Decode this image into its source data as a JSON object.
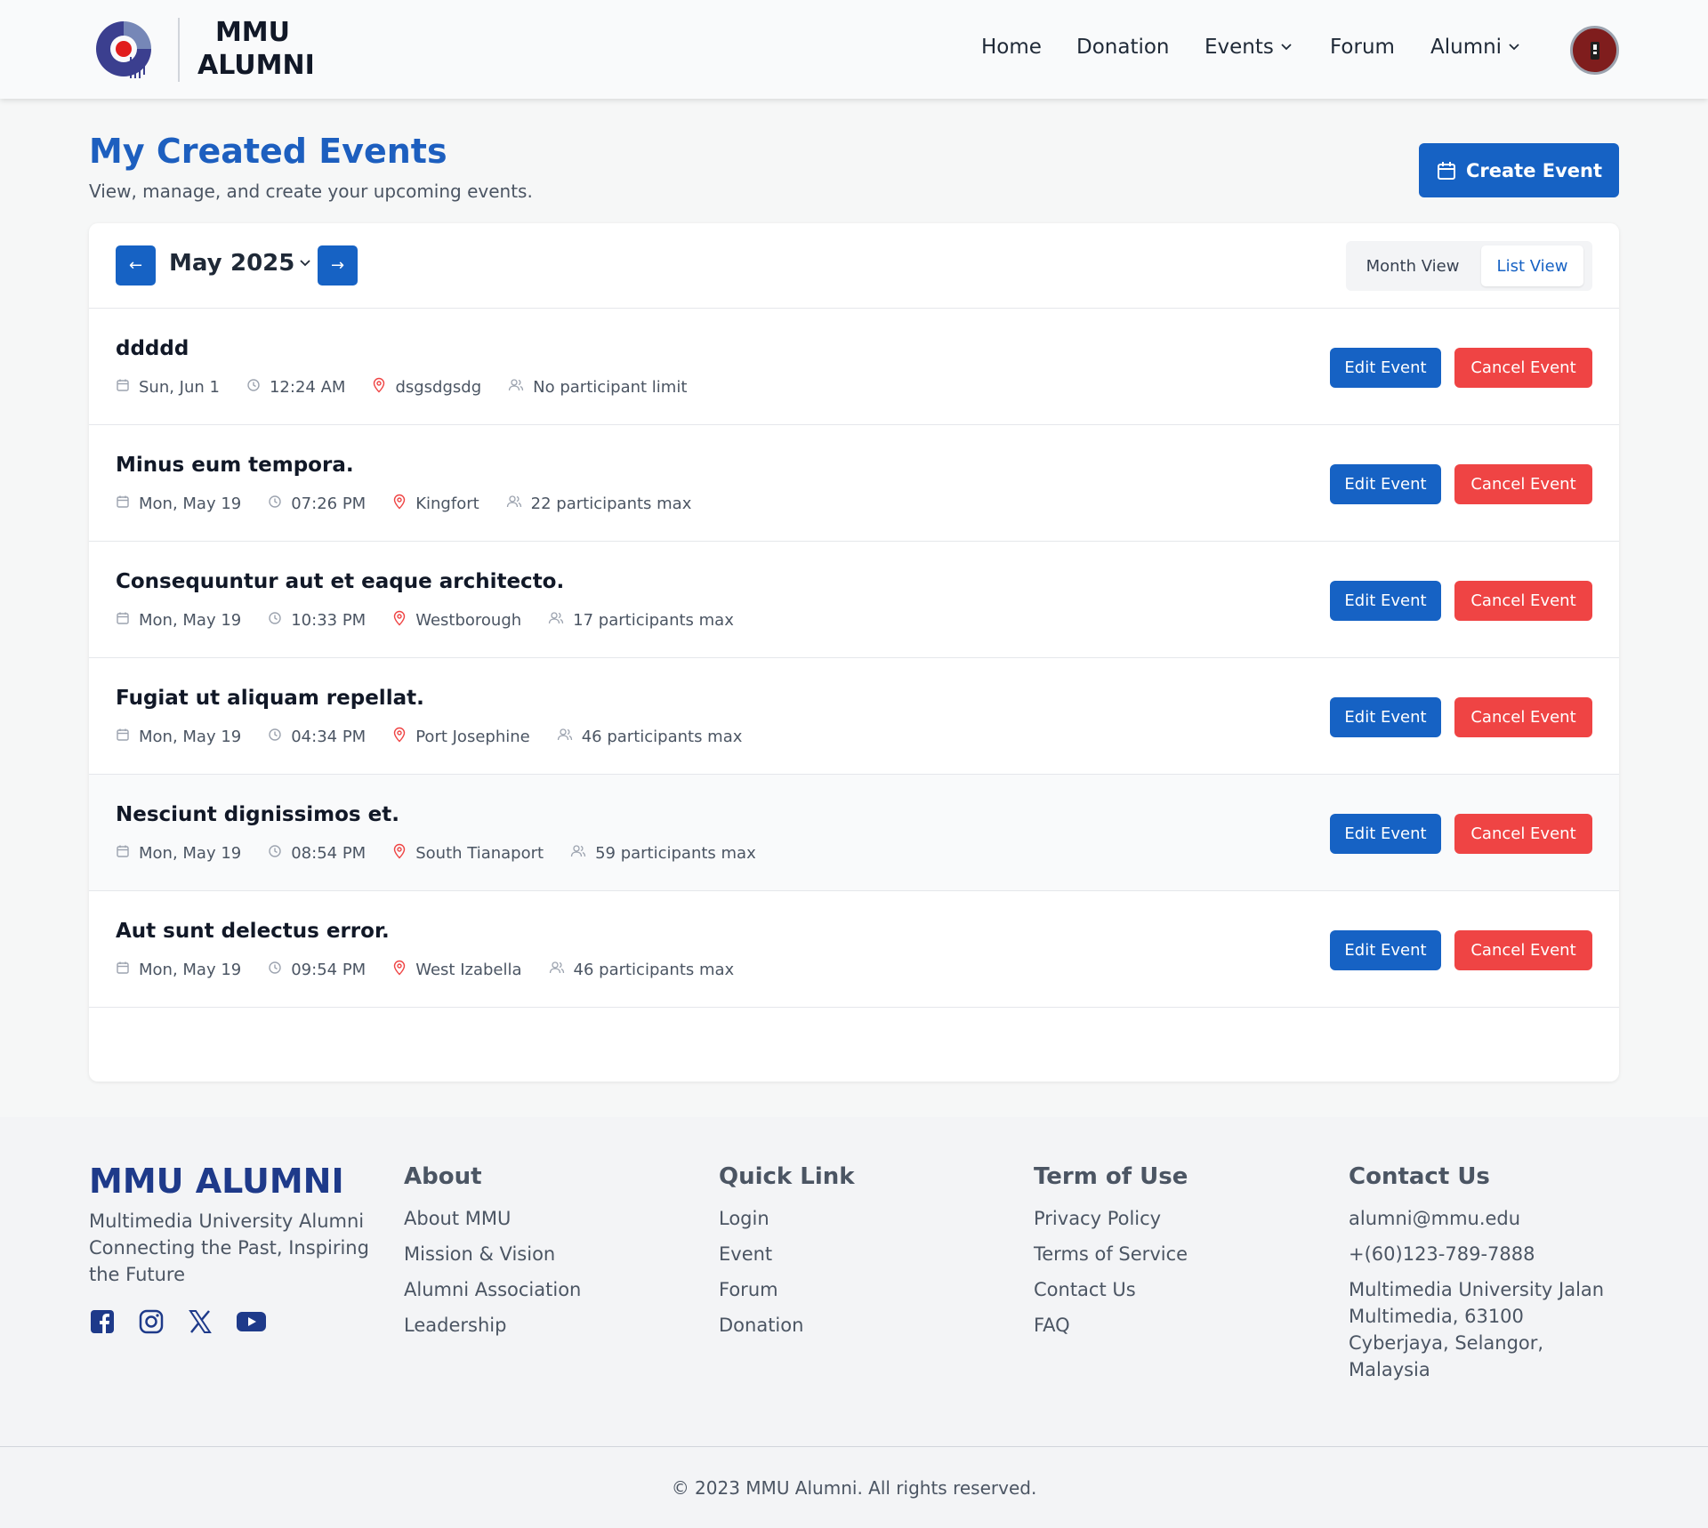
{
  "header": {
    "brand_line1": "MMU",
    "brand_line2": "ALUMNI",
    "nav": [
      {
        "label": "Home"
      },
      {
        "label": "Donation"
      },
      {
        "label": "Events",
        "dropdown": true
      },
      {
        "label": "Forum"
      },
      {
        "label": "Alumni",
        "dropdown": true
      }
    ]
  },
  "page": {
    "title": "My Created Events",
    "subtitle": "View, manage, and create your upcoming events.",
    "create_label": "Create Event"
  },
  "calendar": {
    "prev_icon": "←",
    "next_icon": "→",
    "month": "May",
    "year": "2025",
    "views": [
      "Month View",
      "List View"
    ],
    "active_view": "List View"
  },
  "events": [
    {
      "title": "ddddd",
      "date": "Sun, Jun 1",
      "time": "12:24 AM",
      "location": "dsgsdgsdg",
      "participants": "No participant limit"
    },
    {
      "title": "Minus eum tempora.",
      "date": "Mon, May 19",
      "time": "07:26 PM",
      "location": "Kingfort",
      "participants": "22 participants max"
    },
    {
      "title": "Consequuntur aut et eaque architecto.",
      "date": "Mon, May 19",
      "time": "10:33 PM",
      "location": "Westborough",
      "participants": "17 participants max"
    },
    {
      "title": "Fugiat ut aliquam repellat.",
      "date": "Mon, May 19",
      "time": "04:34 PM",
      "location": "Port Josephine",
      "participants": "46 participants max"
    },
    {
      "title": "Nesciunt dignissimos et.",
      "date": "Mon, May 19",
      "time": "08:54 PM",
      "location": "South Tianaport",
      "participants": "59 participants max"
    },
    {
      "title": "Aut sunt delectus error.",
      "date": "Mon, May 19",
      "time": "09:54 PM",
      "location": "West Izabella",
      "participants": "46 participants max"
    }
  ],
  "actions": {
    "edit": "Edit Event",
    "cancel": "Cancel Event"
  },
  "footer": {
    "brand": "MMU ALUMNI",
    "tagline": "Multimedia University Alumni Connecting the Past, Inspiring the Future",
    "columns": [
      {
        "heading": "About",
        "links": [
          "About MMU",
          "Mission & Vision",
          "Alumni Association",
          "Leadership"
        ]
      },
      {
        "heading": "Quick Link",
        "links": [
          "Login",
          "Event",
          "Forum",
          "Donation"
        ]
      },
      {
        "heading": "Term of Use",
        "links": [
          "Privacy Policy",
          "Terms of Service",
          "Contact Us",
          "FAQ"
        ]
      }
    ],
    "contact": {
      "heading": "Contact Us",
      "email": "alumni@mmu.edu",
      "phone": "+(60)123-789-7888",
      "address": "Multimedia University Jalan Multimedia, 63100 Cyberjaya, Selangor, Malaysia"
    },
    "copyright": "© 2023 MMU Alumni. All rights reserved."
  },
  "colors": {
    "primary": "#1662c4",
    "danger": "#ef4444",
    "title": "#1d5fbf",
    "footer_brand": "#1e3a8a"
  }
}
